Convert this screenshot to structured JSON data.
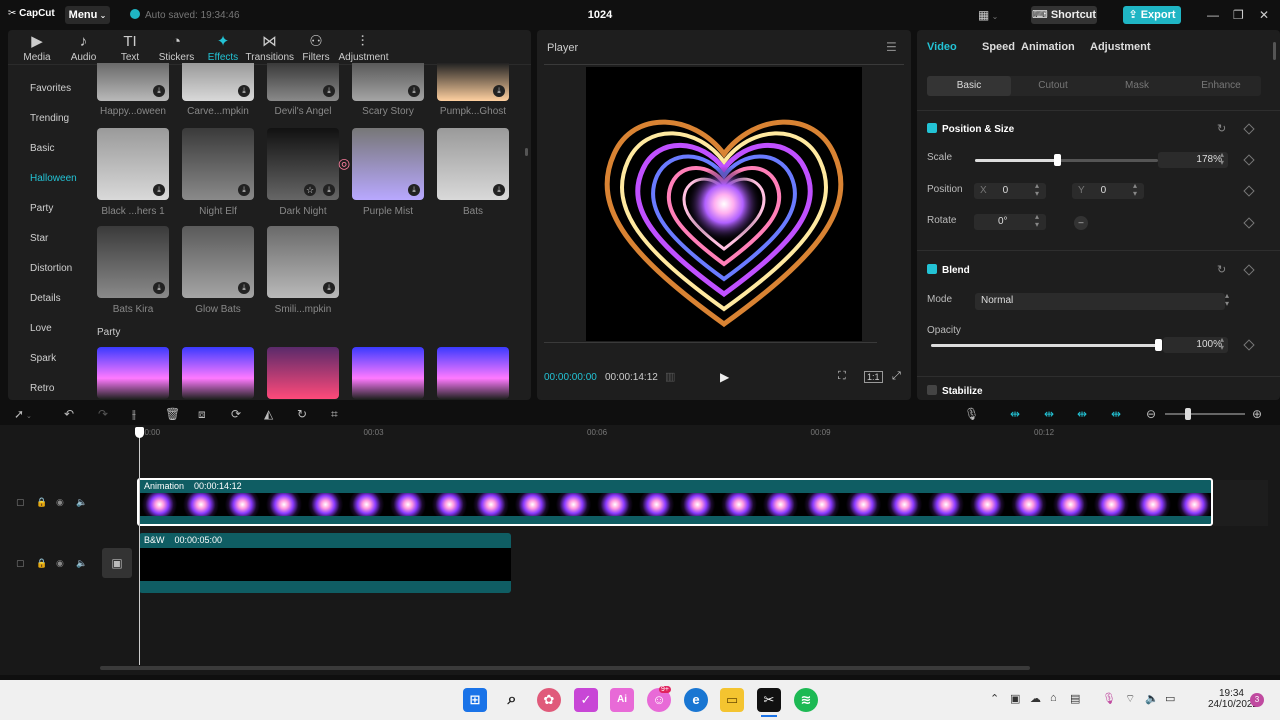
{
  "titlebar": {
    "app_name": "CapCut",
    "menu_label": "Menu",
    "autosave_text": "Auto saved: 19:34:46",
    "project_title": "1024",
    "shortcut_label": "Shortcut",
    "export_label": "Export"
  },
  "tool_tabs": [
    {
      "label": "Media",
      "icon": "media-icon"
    },
    {
      "label": "Audio",
      "icon": "audio-icon"
    },
    {
      "label": "Text",
      "icon": "text-icon"
    },
    {
      "label": "Stickers",
      "icon": "stickers-icon"
    },
    {
      "label": "Effects",
      "icon": "effects-icon",
      "active": true
    },
    {
      "label": "Transitions",
      "icon": "transitions-icon"
    },
    {
      "label": "Filters",
      "icon": "filters-icon"
    },
    {
      "label": "Adjustment",
      "icon": "adjustment-icon"
    }
  ],
  "categories": [
    "Favorites",
    "Trending",
    "Basic",
    "Halloween",
    "Party",
    "Star",
    "Distortion",
    "Details",
    "Love",
    "Spark",
    "Retro"
  ],
  "active_category": "Halloween",
  "effects_row0": [
    "Happy...oween",
    "Carve...mpkin",
    "Devil's Angel",
    "Scary Story",
    "Pumpk...Ghost"
  ],
  "effects_row1": [
    "Black ...hers 1",
    "Night Elf",
    "Dark Night",
    "Purple Mist",
    "Bats"
  ],
  "effects_row2": [
    "Bats Kira",
    "Glow Bats",
    "Smili...mpkin"
  ],
  "party_section_title": "Party",
  "player": {
    "title": "Player",
    "current_time": "00:00:00:00",
    "total_time": "00:00:14:12",
    "ratio_label": "1:1"
  },
  "right_tabs": [
    "Video",
    "Speed",
    "Animation",
    "Adjustment"
  ],
  "sub_tabs": [
    "Basic",
    "Cutout",
    "Mask",
    "Enhance"
  ],
  "position_size": {
    "title": "Position & Size",
    "scale_label": "Scale",
    "scale_value": "178%",
    "scale_level": 0.45,
    "position_label": "Position",
    "x_label": "X",
    "x_value": "0",
    "y_label": "Y",
    "y_value": "0",
    "rotate_label": "Rotate",
    "rotate_value": "0°"
  },
  "blend": {
    "title": "Blend",
    "mode_label": "Mode",
    "mode_value": "Normal",
    "opacity_label": "Opacity",
    "opacity_value": "100%",
    "opacity_level": 1.0
  },
  "stabilize_label": "Stabilize",
  "timeline": {
    "ruler": [
      "00:00",
      "00:03",
      "00:06",
      "00:09",
      "00:12"
    ],
    "clip1_name": "Animation",
    "clip1_duration": "00:00:14:12",
    "clip2_name": "B&W",
    "clip2_duration": "00:00:05:00"
  },
  "taskbar": {
    "time": "19:34",
    "date": "24/10/2022",
    "notification_count": "3",
    "badge": "9+"
  },
  "colors": {
    "accent": "#1fb5c4",
    "clip_teal": "#0f5d63",
    "panel": "#1e1e1e"
  }
}
